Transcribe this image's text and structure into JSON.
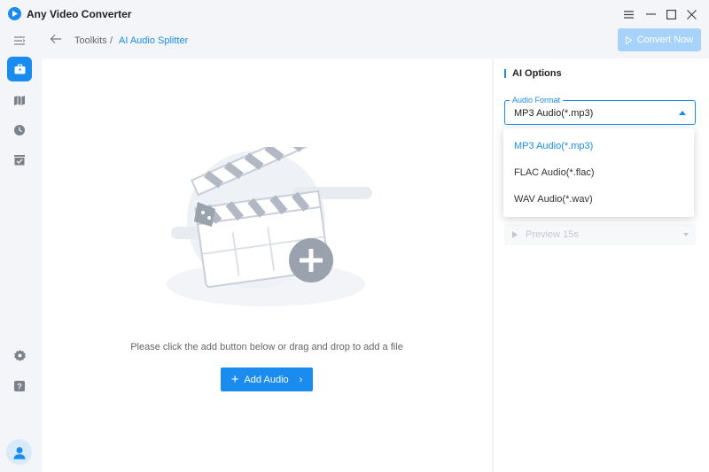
{
  "app": {
    "title": "Any Video Converter"
  },
  "breadcrumb": {
    "root": "Toolkits",
    "separator": "/",
    "current": "AI Audio Splitter"
  },
  "toolbar": {
    "convert_label": "Convert Now"
  },
  "main": {
    "hint": "Please click the add button below or drag and drop to add a file",
    "add_button_label": "Add Audio"
  },
  "options": {
    "title": "AI Options",
    "format_legend": "Audio Format",
    "format_value": "MP3 Audio(*.mp3)",
    "format_options": [
      "MP3 Audio(*.mp3)",
      "FLAC Audio(*.flac)",
      "WAV Audio(*.wav)"
    ],
    "preview_label": "Preview 15s"
  },
  "colors": {
    "accent": "#1a8cf0",
    "accent_disabled": "#a7d3fb",
    "panel": "#ffffff",
    "background": "#f3f5f8"
  },
  "icons": {
    "sidebar": [
      "menu-icon",
      "toolbox-icon",
      "map-icon",
      "history-icon",
      "tasks-icon",
      "settings-icon",
      "help-icon",
      "avatar-icon"
    ],
    "window": [
      "menu-icon",
      "minimize-icon",
      "maximize-icon",
      "close-icon"
    ]
  }
}
